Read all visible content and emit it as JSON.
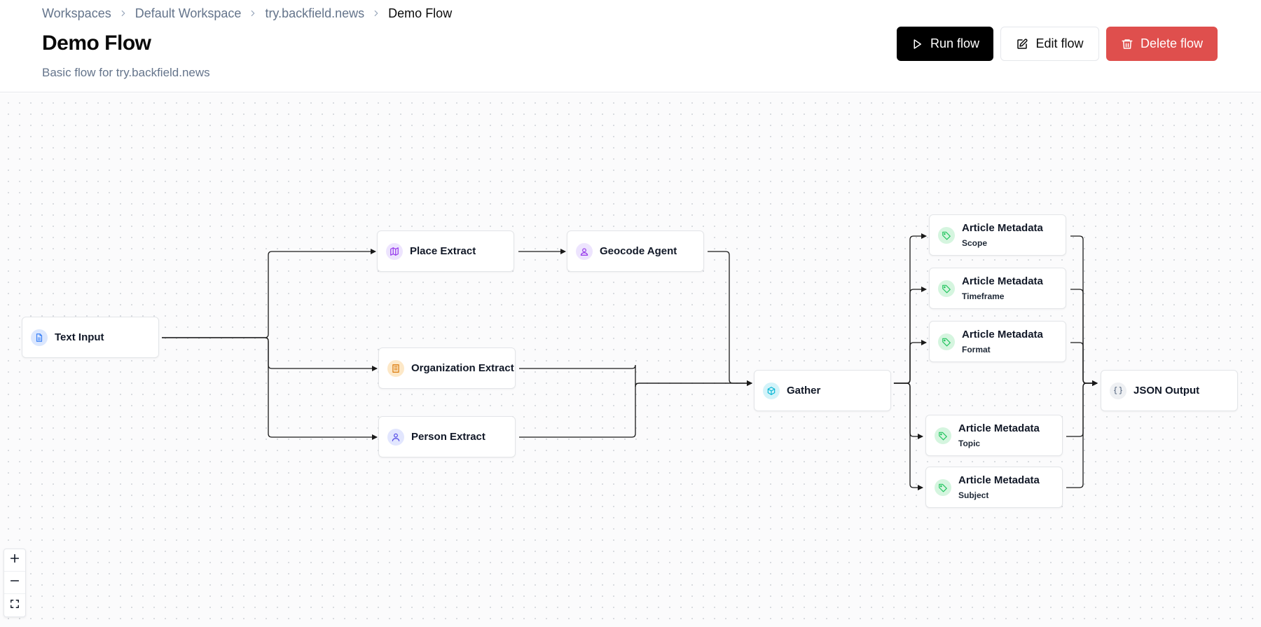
{
  "breadcrumb": {
    "items": [
      "Workspaces",
      "Default Workspace",
      "try.backfield.news",
      "Demo Flow"
    ]
  },
  "page": {
    "title": "Demo Flow",
    "subtitle": "Basic flow for try.backfield.news"
  },
  "actions": {
    "run_label": "Run flow",
    "edit_label": "Edit flow",
    "delete_label": "Delete flow"
  },
  "nodes": {
    "text_input": {
      "label": "Text Input",
      "icon": "file-text-icon"
    },
    "place_extract": {
      "label": "Place Extract",
      "icon": "map-icon"
    },
    "geocode_agent": {
      "label": "Geocode Agent",
      "icon": "user-icon"
    },
    "organization_extract": {
      "label": "Organization Extract",
      "icon": "building-icon"
    },
    "person_extract": {
      "label": "Person Extract",
      "icon": "user-icon"
    },
    "gather": {
      "label": "Gather",
      "icon": "box-icon"
    },
    "meta_scope": {
      "label": "Article Metadata",
      "sub": "Scope",
      "icon": "tag-icon"
    },
    "meta_timeframe": {
      "label": "Article Metadata",
      "sub": "Timeframe",
      "icon": "tag-icon"
    },
    "meta_format": {
      "label": "Article Metadata",
      "sub": "Format",
      "icon": "tag-icon"
    },
    "meta_topic": {
      "label": "Article Metadata",
      "sub": "Topic",
      "icon": "tag-icon"
    },
    "meta_subject": {
      "label": "Article Metadata",
      "sub": "Subject",
      "icon": "tag-icon"
    },
    "json_output": {
      "label": "JSON Output",
      "icon": "braces-icon"
    }
  },
  "colors": {
    "primary": "#000000",
    "danger": "#df4f4d",
    "muted_text": "#64748b",
    "edge": "#1a1a1a"
  },
  "zoom_controls": [
    "zoom-in",
    "zoom-out",
    "fit-view"
  ]
}
